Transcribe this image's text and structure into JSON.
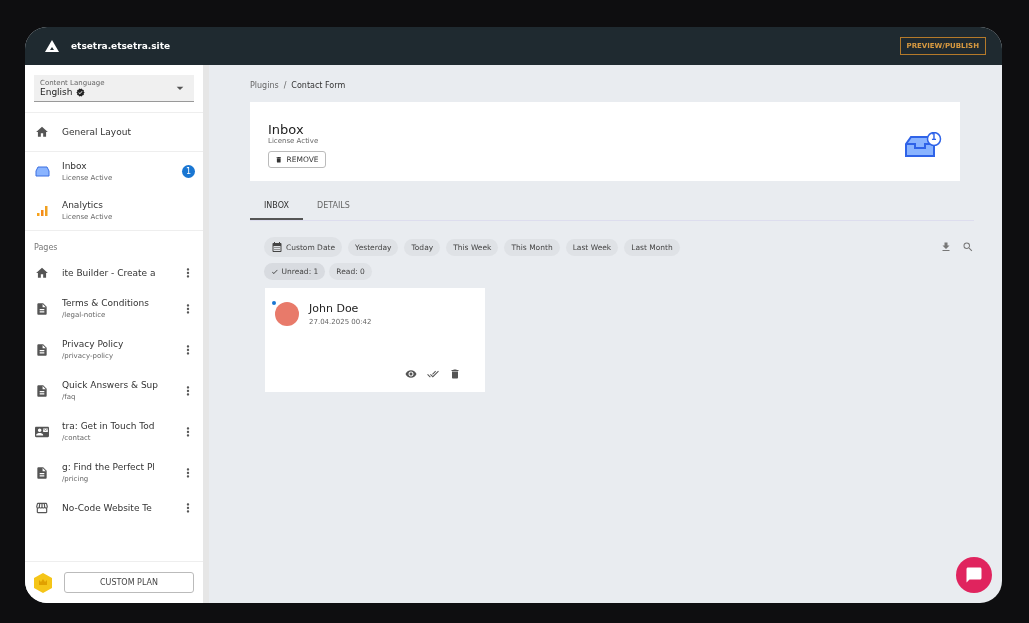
{
  "header": {
    "site": "etsetra.etsetra.site",
    "action": "PREVIEW/PUBLISH"
  },
  "sidebar": {
    "language": {
      "label": "Content Language",
      "value": "English"
    },
    "plugins": [
      {
        "kind": "home",
        "title": "General Layout"
      },
      {
        "kind": "inbox",
        "title": "Inbox",
        "subtitle": "License Active",
        "badge": "1"
      },
      {
        "kind": "analytics",
        "title": "Analytics",
        "subtitle": "License Active"
      }
    ],
    "pages_heading": "Pages",
    "pages": [
      {
        "kind": "home",
        "title": "ite Builder - Create a"
      },
      {
        "kind": "doc",
        "title": "Terms & Conditions",
        "path": "/legal-notice"
      },
      {
        "kind": "doc",
        "title": "Privacy Policy",
        "path": "/privacy-policy"
      },
      {
        "kind": "doc",
        "title": "Quick Answers & Sup",
        "path": "/faq"
      },
      {
        "kind": "contact",
        "title": "tra: Get in Touch Tod",
        "path": "/contact"
      },
      {
        "kind": "doc",
        "title": "g: Find the Perfect Pl",
        "path": "/pricing"
      },
      {
        "kind": "store",
        "title": "No-Code Website Te"
      }
    ],
    "plan_button": "CUSTOM PLAN"
  },
  "breadcrumb": [
    "Plugins",
    "Contact Form"
  ],
  "breadcrumb_separator": "/",
  "plugin": {
    "title": "Inbox",
    "status": "License Active",
    "remove_button": "REMOVE",
    "badge": "1"
  },
  "tabs": [
    {
      "label": "INBOX",
      "selected": true
    },
    {
      "label": "DETAILS",
      "selected": false
    }
  ],
  "date_filters": [
    {
      "label": "Custom Date",
      "kind": "calendar"
    },
    {
      "label": "Yesterday"
    },
    {
      "label": "Today"
    },
    {
      "label": "This Week"
    },
    {
      "label": "This Month"
    },
    {
      "label": "Last Week"
    },
    {
      "label": "Last Month"
    }
  ],
  "status_filters": [
    {
      "label": "Unread: 1",
      "selected": true
    },
    {
      "label": "Read: 0",
      "selected": false
    }
  ],
  "messages": [
    {
      "name": "John Doe",
      "date": "27.04.2025 00:42",
      "unread": true
    }
  ]
}
